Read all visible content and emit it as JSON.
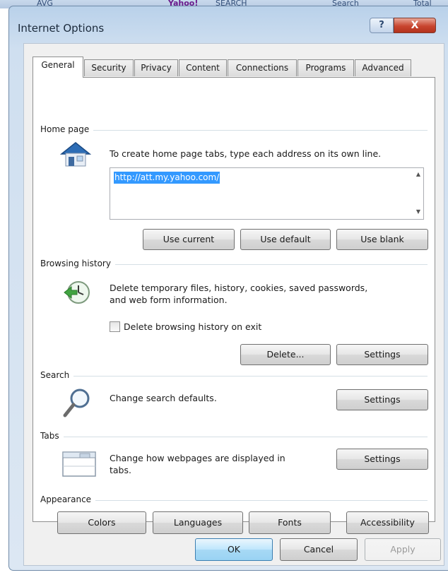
{
  "background_bar": {
    "fragments": [
      "AVG",
      "Yahoo!",
      "SEARCH",
      "Search",
      "Total"
    ]
  },
  "window": {
    "title": "Internet Options",
    "help_glyph": "?",
    "close_glyph": "X"
  },
  "tabs": [
    {
      "label": "General"
    },
    {
      "label": "Security"
    },
    {
      "label": "Privacy"
    },
    {
      "label": "Content"
    },
    {
      "label": "Connections"
    },
    {
      "label": "Programs"
    },
    {
      "label": "Advanced"
    }
  ],
  "home_page": {
    "heading": "Home page",
    "instructions": "To create home page tabs, type each address on its own line.",
    "url": "http://att.my.yahoo.com/",
    "use_current": "Use current",
    "use_default": "Use default",
    "use_blank": "Use blank"
  },
  "browsing_history": {
    "heading": "Browsing history",
    "description_line1": "Delete temporary files, history, cookies, saved passwords,",
    "description_line2": "and web form information.",
    "delete_on_exit_label": "Delete browsing history on exit",
    "delete_on_exit_checked": false,
    "delete_button": "Delete...",
    "settings_button": "Settings"
  },
  "search": {
    "heading": "Search",
    "description": "Change search defaults.",
    "settings_button": "Settings"
  },
  "tabs_section": {
    "heading": "Tabs",
    "description_line1": "Change how webpages are displayed in",
    "description_line2": "tabs.",
    "settings_button": "Settings"
  },
  "appearance": {
    "heading": "Appearance",
    "colors": "Colors",
    "languages": "Languages",
    "fonts": "Fonts",
    "accessibility": "Accessibility"
  },
  "footer": {
    "ok": "OK",
    "cancel": "Cancel",
    "apply": "Apply"
  }
}
